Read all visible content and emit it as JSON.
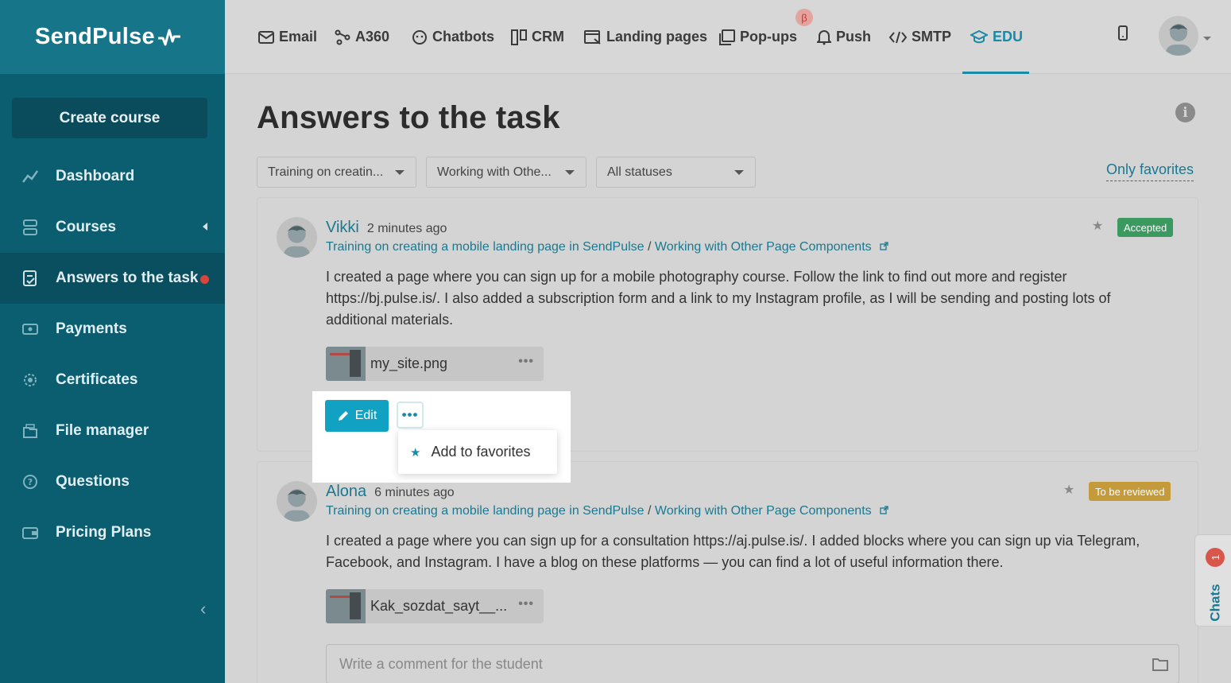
{
  "app": {
    "logo": "SendPulse"
  },
  "sidebar": {
    "create_label": "Create course",
    "items": [
      {
        "label": "Dashboard",
        "icon": "dashboard-icon"
      },
      {
        "label": "Courses",
        "icon": "courses-icon"
      },
      {
        "label": "Answers to the task",
        "icon": "answers-icon"
      },
      {
        "label": "Payments",
        "icon": "payments-icon"
      },
      {
        "label": "Certificates",
        "icon": "certificates-icon"
      },
      {
        "label": "File manager",
        "icon": "file-manager-icon"
      },
      {
        "label": "Questions",
        "icon": "questions-icon"
      },
      {
        "label": "Pricing Plans",
        "icon": "pricing-icon"
      }
    ],
    "collapse_glyph": "‹"
  },
  "topnav": {
    "items": [
      {
        "label": "Email",
        "icon": "mail-icon"
      },
      {
        "label": "A360",
        "icon": "a360-icon"
      },
      {
        "label": "Chatbots",
        "icon": "chatbot-icon"
      },
      {
        "label": "CRM",
        "icon": "crm-icon"
      },
      {
        "label": "Landing pages",
        "icon": "landing-icon"
      },
      {
        "label": "Pop-ups",
        "icon": "popup-icon"
      },
      {
        "label": "Push",
        "icon": "bell-icon"
      },
      {
        "label": "SMTP",
        "icon": "code-icon"
      },
      {
        "label": "EDU",
        "icon": "graduation-cap-icon"
      }
    ],
    "beta": "β",
    "active_color": "#1a8aa6"
  },
  "page": {
    "title": "Answers to the task",
    "info": "i",
    "filters": {
      "course": "Training on creatin...",
      "lesson": "Working with Othe...",
      "status": "All statuses"
    },
    "only_favorites": "Only favorites"
  },
  "answers": [
    {
      "author": "Vikki",
      "time": "2 minutes ago",
      "course": "Training on creating a mobile landing page in SendPulse",
      "separator": "/",
      "lesson": "Working with Other Page Components",
      "status": "Accepted",
      "text": "I created a page where you can sign up for a mobile photography course. Follow the link to find out more and register https://bj.pulse.is/. I also added a subscription form and a link to my Instagram profile, as I will be sending and posting lots of additional materials.",
      "file": "my_site.png",
      "file_more": "•••",
      "edit_label": "Edit",
      "more_label": "•••",
      "menu_item": "Add to favorites"
    },
    {
      "author": "Alona",
      "time": "6 minutes ago",
      "course": "Training on creating a mobile landing page in SendPulse",
      "separator": "/",
      "lesson": "Working with Other Page Components",
      "status": "To be reviewed",
      "text": "I created a page where you can sign up for a consultation https://aj.pulse.is/. I added blocks where you can sign up via Telegram, Facebook, and Instagram. I have a blog on these platforms — you can find a lot of useful information there.",
      "file": "Kak_sozdat_sayt__...",
      "file_more": "•••",
      "comment_placeholder": "Write a comment for the student"
    }
  ],
  "chats": {
    "label": "Chats",
    "count": "1"
  },
  "colors": {
    "accent": "#1a8aa6",
    "sidebar": "#0a5e70",
    "accepted": "#3b9a5f",
    "review": "#c49a3a"
  }
}
